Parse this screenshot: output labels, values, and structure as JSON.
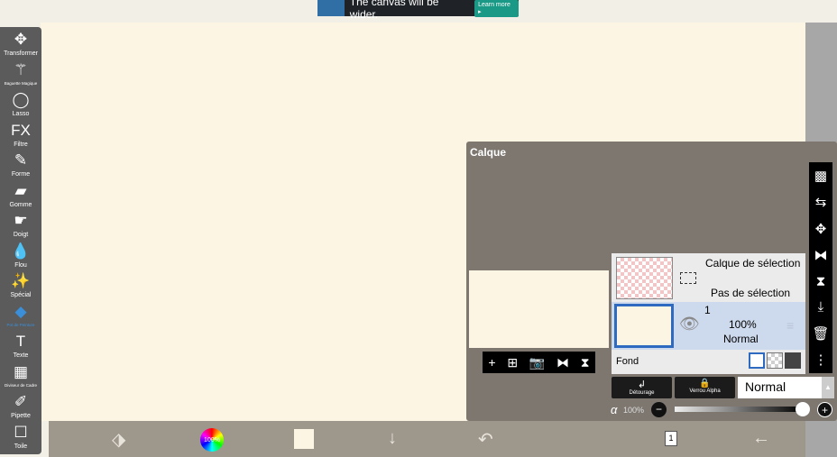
{
  "ad": {
    "text": "The canvas will be wider.",
    "cta": "Learn more ▸"
  },
  "tools": [
    {
      "icon": "✥",
      "label": "Transformer",
      "name": "move-icon"
    },
    {
      "icon": "⚚",
      "label": "Baguette Magique",
      "name": "magic-wand-icon",
      "small": true
    },
    {
      "icon": "◯",
      "label": "Lasso",
      "name": "lasso-icon"
    },
    {
      "icon": "FX",
      "label": "Filtre",
      "name": "fx-icon"
    },
    {
      "icon": "✎",
      "label": "Forme",
      "name": "brush-icon"
    },
    {
      "icon": "▰",
      "label": "Gomme",
      "name": "eraser-icon"
    },
    {
      "icon": "☛",
      "label": "Doigt",
      "name": "finger-icon"
    },
    {
      "icon": "💧",
      "label": "Flou",
      "name": "blur-drop-icon"
    },
    {
      "icon": "✨",
      "label": "Spécial",
      "name": "special-icon"
    },
    {
      "icon": "◆",
      "label": "Pot de Peinture",
      "name": "bucket-icon",
      "small": true,
      "active": true
    },
    {
      "icon": "T",
      "label": "Texte",
      "name": "text-icon"
    },
    {
      "icon": "▦",
      "label": "Diviseur de Cadre",
      "name": "frame-divider-icon",
      "small": true
    },
    {
      "icon": "✐",
      "label": "Pipette",
      "name": "eyedropper-icon"
    },
    {
      "icon": "☐",
      "label": "Toile",
      "name": "canvas-icon"
    }
  ],
  "bottom": {
    "color_label": "100%",
    "pages": "1"
  },
  "panel": {
    "title": "Calque",
    "selection_layer": "Calque de sélection",
    "no_selection": "Pas de sélection",
    "layer": {
      "name": "1",
      "opacity": "100%",
      "blend": "Normal"
    },
    "fond": "Fond",
    "clipping": "Détourage",
    "alpha_lock": "Verrou Alpha",
    "blend_mode": "Normal",
    "alpha_symbol": "α",
    "alpha_value": "100%",
    "alpha_fraction": 1.0
  },
  "colors": {
    "canvas": "#fdf5e4",
    "accent": "#2e6bc0",
    "panel": "#7d7770"
  }
}
